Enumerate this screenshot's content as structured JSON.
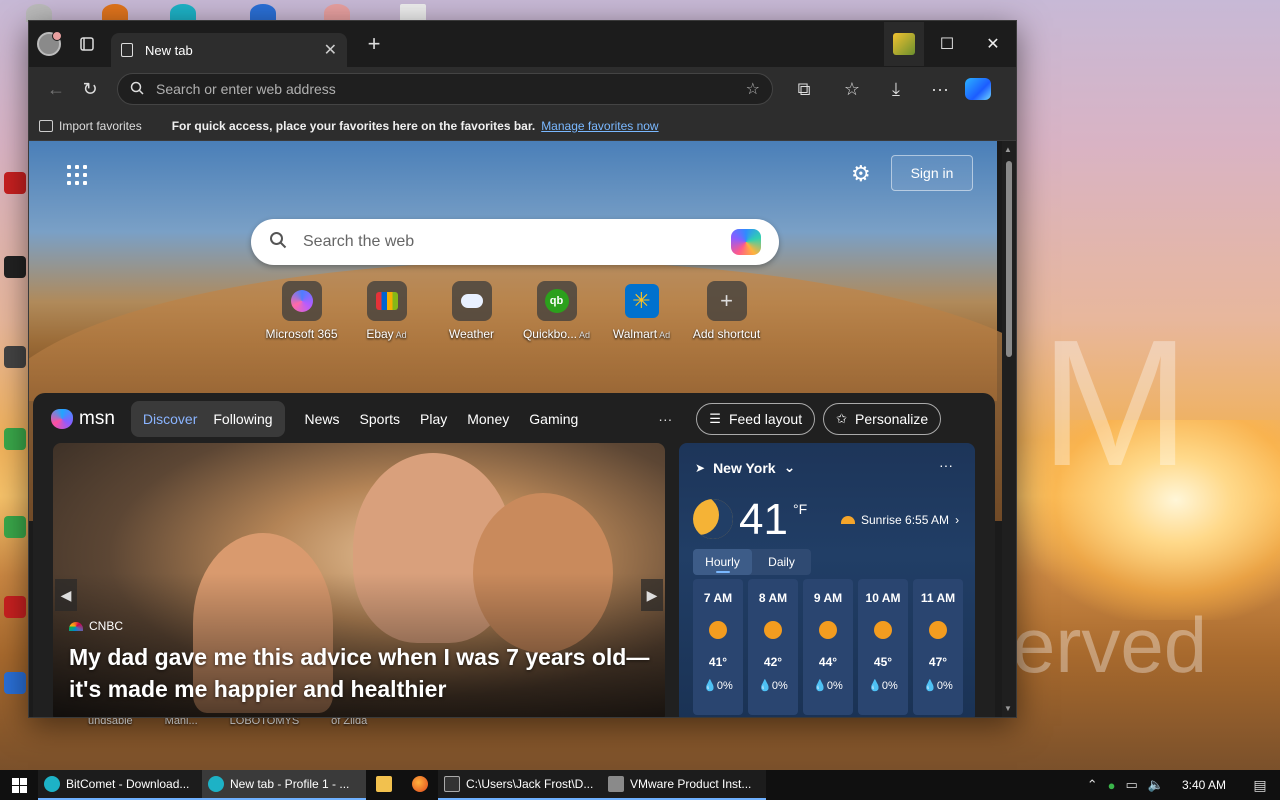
{
  "browser": {
    "tab_title": "New tab",
    "address_placeholder": "Search or enter web address",
    "favbar": {
      "import_label": "Import favorites",
      "message": "For quick access, place your favorites here on the favorites bar.",
      "manage_link": "Manage favorites now"
    }
  },
  "newtab": {
    "signin_label": "Sign in",
    "search_placeholder": "Search the web",
    "shortcuts": [
      {
        "label": "Microsoft 365",
        "ad": ""
      },
      {
        "label": "Ebay",
        "ad": "Ad"
      },
      {
        "label": "Weather",
        "ad": ""
      },
      {
        "label": "Quickbo...",
        "ad": "Ad"
      },
      {
        "label": "Walmart",
        "ad": "Ad"
      },
      {
        "label": "Add shortcut",
        "ad": ""
      }
    ]
  },
  "feed": {
    "brand": "msn",
    "pills": [
      "Discover",
      "Following"
    ],
    "nav": [
      "News",
      "Sports",
      "Play",
      "Money",
      "Gaming"
    ],
    "more": "···",
    "feed_layout_label": "Feed layout",
    "personalize_label": "Personalize",
    "hero": {
      "source": "CNBC",
      "title": "My dad gave me this advice when I was 7 years old—it's made me happier and healthier"
    },
    "weather": {
      "location": "New York",
      "temp": "41",
      "unit": "°F",
      "sunrise": "Sunrise 6:55 AM",
      "toggle": [
        "Hourly",
        "Daily"
      ],
      "hours": [
        {
          "time": "7 AM",
          "temp": "41°",
          "precip": "0%"
        },
        {
          "time": "8 AM",
          "temp": "42°",
          "precip": "0%"
        },
        {
          "time": "9 AM",
          "temp": "44°",
          "precip": "0%"
        },
        {
          "time": "10 AM",
          "temp": "45°",
          "precip": "0%"
        },
        {
          "time": "11 AM",
          "temp": "47°",
          "precip": "0%"
        }
      ]
    }
  },
  "desktop": {
    "behind_labels": [
      "undsable",
      "Mani...",
      "LOBOTOMYS",
      "of Zilda"
    ],
    "watermark_letter": "M",
    "watermark_text": "erved"
  },
  "taskbar": {
    "tasks": [
      {
        "label": "BitComet - Download..."
      },
      {
        "label": "New tab - Profile 1 - ..."
      },
      {
        "label": "C:\\Users\\Jack Frost\\D..."
      },
      {
        "label": "VMware Product Inst..."
      }
    ],
    "clock": "3:40 AM"
  }
}
